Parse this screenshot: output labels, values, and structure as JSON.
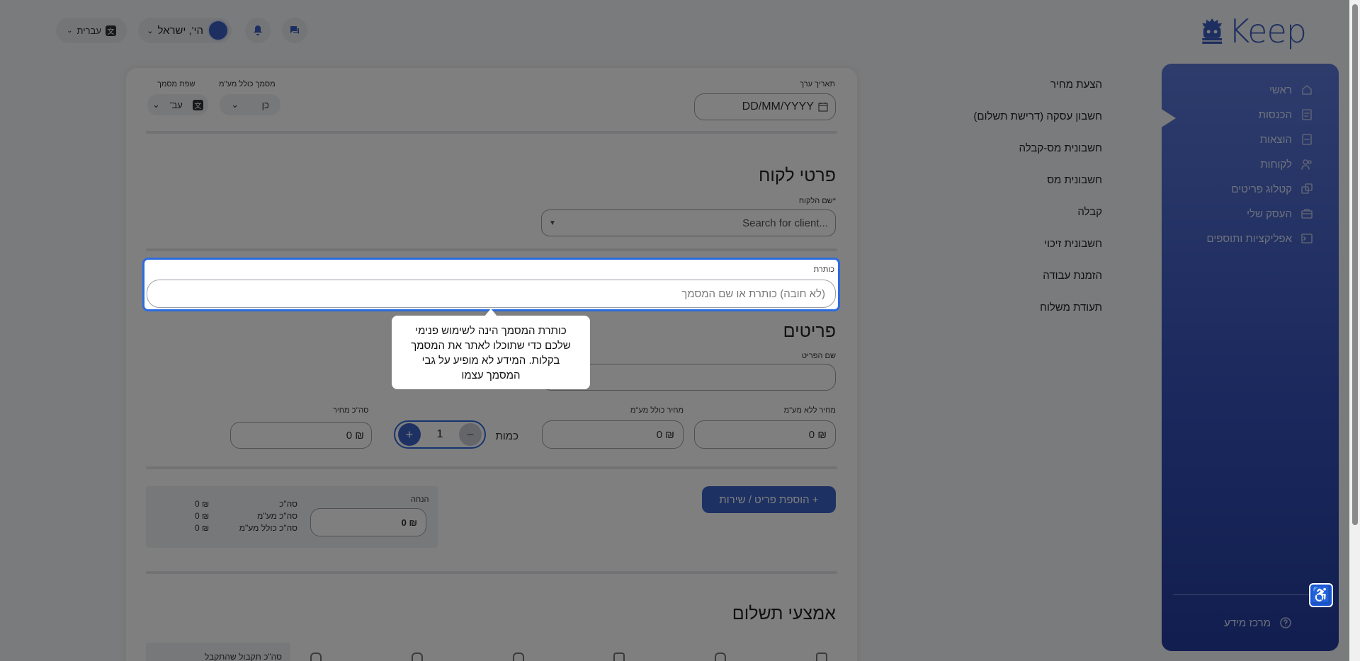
{
  "brand": {
    "name": "Keep"
  },
  "header": {
    "language_label": "עברית",
    "user_name": "הי', ישראל"
  },
  "sidebar": {
    "items": [
      {
        "label": "ראשי",
        "icon": "home-icon"
      },
      {
        "label": "הכנסות",
        "icon": "income-icon"
      },
      {
        "label": "הוצאות",
        "icon": "expenses-icon"
      },
      {
        "label": "לקוחות",
        "icon": "users-icon"
      },
      {
        "label": "קטלוג פריטים",
        "icon": "catalog-icon"
      },
      {
        "label": "העסק שלי",
        "icon": "briefcase-icon"
      },
      {
        "label": "אפליקציות ותוספים",
        "icon": "apps-icon"
      }
    ],
    "help_label": "מרכז מידע"
  },
  "doc_types": [
    "הצעת מחיר",
    "חשבון עסקה (דרישת תשלום)",
    "חשבונית מס-קבלה",
    "חשבונית מס",
    "קבלה",
    "חשבונית זיכוי",
    "הזמנת עבודה",
    "תעודת משלוח"
  ],
  "doc_settings": {
    "date_label": "תאריך ערך",
    "date_placeholder": "DD/MM/YYYY",
    "vat_label": "מסמך כולל מע\"מ",
    "vat_value": "כן",
    "lang_label": "שפת מסמך",
    "lang_value": "עב'"
  },
  "client": {
    "heading": "פרטי לקוח",
    "name_label": "*שם הלקוח",
    "search_placeholder": "Search for client..."
  },
  "title_field": {
    "label": "כותרת",
    "placeholder": "(לא חובה) כותרת או שם המסמך"
  },
  "tooltip": {
    "text": "כותרת המסמך הינה לשימוש פנימי שלכם כדי שתוכלו לאתר את המסמך בקלות. המידע לא מופיע על גבי המסמך עצמו"
  },
  "items": {
    "heading": "פריטים",
    "item_name_label": "שם הפריט",
    "price_excl_label": "מחיר ללא מע\"מ",
    "price_incl_label": "מחיר כולל מע\"מ",
    "quantity_label": "כמות",
    "quantity_value": "1",
    "total_price_label": "סה\"כ מחיר",
    "zero_amount": "₪ 0",
    "add_button": "+ הוספת פריט / שירות"
  },
  "summary": {
    "discount_label": "הנחה",
    "discount_value": "₪ 0",
    "rows": [
      {
        "label": "סה\"כ",
        "value": "₪ 0"
      },
      {
        "label": "סה\"כ מע\"מ",
        "value": "₪ 0"
      },
      {
        "label": "סה\"כ כולל מע\"מ",
        "value": "₪ 0"
      }
    ]
  },
  "payment": {
    "heading": "אמצעי תשלום",
    "received_label": "סה\"כ תקבול שהתקבל"
  },
  "colors": {
    "accent": "#2d6be0",
    "sidebar": "#3652bb",
    "button": "#3a63c7"
  }
}
